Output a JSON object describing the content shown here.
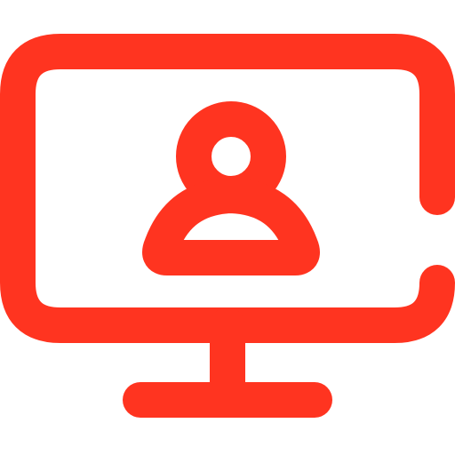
{
  "icon": {
    "name": "monitor-user-icon",
    "color": "#FF3420"
  }
}
